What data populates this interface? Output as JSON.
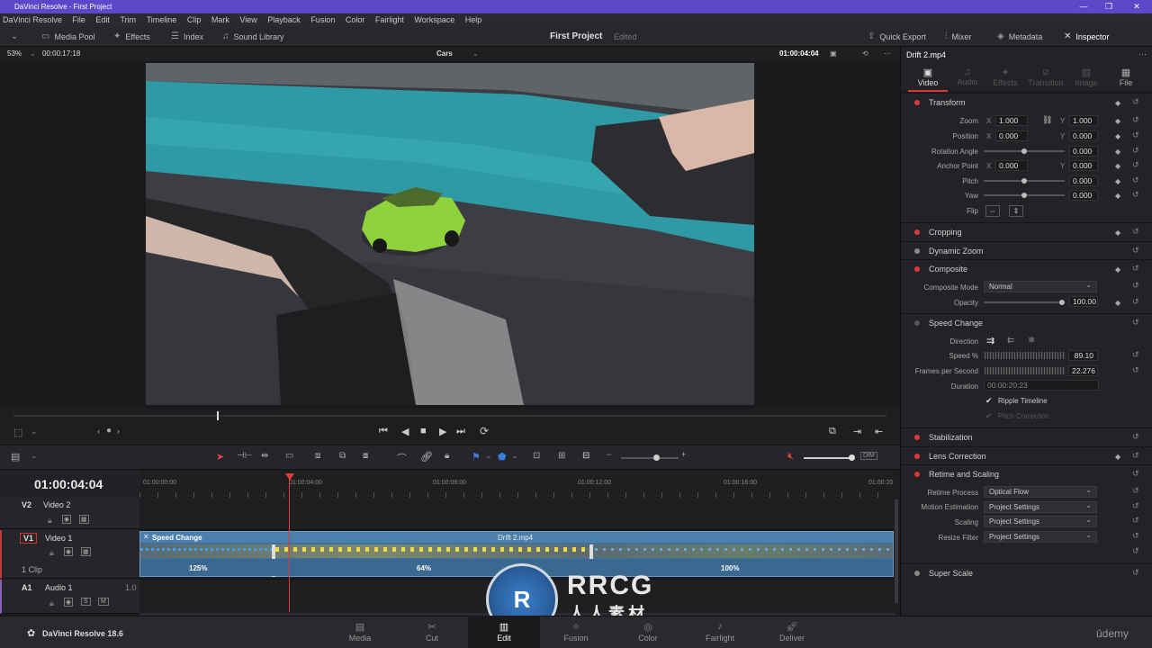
{
  "window": {
    "title": "DaVinci Resolve - First Project"
  },
  "menu": [
    "DaVinci Resolve",
    "File",
    "Edit",
    "Trim",
    "Timeline",
    "Clip",
    "Mark",
    "View",
    "Playback",
    "Fusion",
    "Color",
    "Fairlight",
    "Workspace",
    "Help"
  ],
  "toolbar": {
    "media_pool": "Media Pool",
    "effects": "Effects",
    "index": "Index",
    "sound_library": "Sound Library",
    "project_name": "First Project",
    "project_status": "Edited",
    "quick_export": "Quick Export",
    "mixer": "Mixer",
    "metadata": "Metadata",
    "inspector": "Inspector"
  },
  "viewer": {
    "zoom": "53%",
    "source_tc": "00:00:17:18",
    "timeline_name": "Cars",
    "record_tc": "01:00:04:04"
  },
  "inspector": {
    "clip_name": "Drift 2.mp4",
    "tabs": [
      "Video",
      "Audio",
      "Effects",
      "Transition",
      "Image",
      "File"
    ],
    "transform": {
      "title": "Transform",
      "zoom_label": "Zoom",
      "zoom_x": "1.000",
      "zoom_y": "1.000",
      "position_label": "Position",
      "pos_x": "0.000",
      "pos_y": "0.000",
      "rotation_label": "Rotation Angle",
      "rotation": "0.000",
      "anchor_label": "Anchor Point",
      "anchor_x": "0.000",
      "anchor_y": "0.000",
      "pitch_label": "Pitch",
      "pitch": "0.000",
      "yaw_label": "Yaw",
      "yaw": "0.000",
      "flip_label": "Flip",
      "x": "X",
      "y": "Y"
    },
    "cropping": "Cropping",
    "dynamic_zoom": "Dynamic Zoom",
    "composite": {
      "title": "Composite",
      "mode_label": "Composite Mode",
      "mode": "Normal",
      "opacity_label": "Opacity",
      "opacity": "100.00"
    },
    "speed_change": {
      "title": "Speed Change",
      "direction_label": "Direction",
      "speed_label": "Speed %",
      "speed": "89.10",
      "fps_label": "Frames per Second",
      "fps": "22.276",
      "duration_label": "Duration",
      "duration": "00:00:20:23",
      "ripple": "Ripple Timeline",
      "pitch_correction": "Pitch Correction"
    },
    "stabilization": "Stabilization",
    "lens_correction": "Lens Correction",
    "retime": {
      "title": "Retime and Scaling",
      "process_label": "Retime Process",
      "process": "Optical Flow",
      "motion_label": "Motion Estimation",
      "motion": "Project Settings",
      "scaling_label": "Scaling",
      "scaling": "Project Settings",
      "resize_label": "Resize Filter",
      "resize": "Project Settings"
    },
    "super_scale": "Super Scale"
  },
  "timeline": {
    "timecode": "01:00:04:04",
    "ruler": [
      "01:00:00:00",
      "01:00:04:00",
      "01:00:08:00",
      "01:00:12:00",
      "01:00:16:00",
      "01:00:20"
    ],
    "tracks": {
      "v2": {
        "id": "V2",
        "name": "Video 2"
      },
      "v1": {
        "id": "V1",
        "name": "Video 1",
        "clips": "1 Clip"
      },
      "a1": {
        "id": "A1",
        "name": "Audio 1",
        "level": "1.0"
      }
    },
    "clip": {
      "title": "Drift 2.mp4",
      "effect": "Speed Change",
      "speeds": [
        "125%",
        "64%",
        "100%"
      ]
    }
  },
  "bottom": {
    "app": "DaVinci Resolve 18.6",
    "pages": [
      "Media",
      "Cut",
      "Edit",
      "Fusion",
      "Color",
      "Fairlight",
      "Deliver"
    ],
    "active_page": "Edit",
    "brand": "ūdemy",
    "watermark_top": "RRCG",
    "watermark_bottom": "人人素材"
  },
  "colors": {
    "accent": "#5b49c9",
    "playhead": "#e03a3a",
    "clip": "#3f6f9b",
    "active_dot": "#d83a3a"
  }
}
